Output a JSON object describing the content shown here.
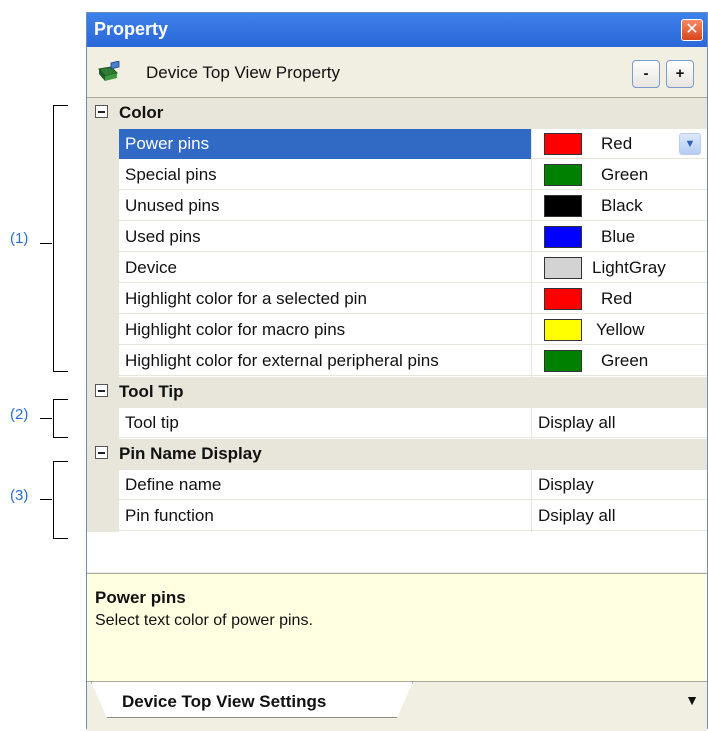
{
  "callouts": [
    "(1)",
    "(2)",
    "(3)"
  ],
  "panel": {
    "title": "Property",
    "close_glyph": "✕",
    "header_title": "Device Top View Property",
    "collapse_label": "-",
    "expand_label": "+",
    "icon": "device-chip-icon"
  },
  "categories": [
    {
      "label": "Color",
      "properties": [
        {
          "name": "Power pins",
          "value": "Red",
          "color": "#ff0000",
          "selected": true
        },
        {
          "name": "Special pins",
          "value": "Green",
          "color": "#008000"
        },
        {
          "name": "Unused pins",
          "value": "Black",
          "color": "#000000"
        },
        {
          "name": "Used pins",
          "value": "Blue",
          "color": "#0000ff"
        },
        {
          "name": "Device",
          "value": "LightGray",
          "color": "#d3d3d3"
        },
        {
          "name": "Highlight color for a selected pin",
          "value": "Red",
          "color": "#ff0000"
        },
        {
          "name": "Highlight color for macro pins",
          "value": "Yellow",
          "color": "#ffff00"
        },
        {
          "name": "Highlight color for external peripheral pins",
          "value": "Green",
          "color": "#008000"
        }
      ]
    },
    {
      "label": "Tool Tip",
      "properties": [
        {
          "name": "Tool tip",
          "value": "Display all"
        }
      ]
    },
    {
      "label": "Pin Name Display",
      "properties": [
        {
          "name": "Define name",
          "value": "Display"
        },
        {
          "name": "Pin function",
          "value": "Dsiplay all"
        }
      ]
    }
  ],
  "description": {
    "title": "Power pins",
    "text": "Select text color of power pins."
  },
  "tab": {
    "label": "Device Top View Settings",
    "menu_glyph": "▼"
  },
  "colors": {
    "selection": "#316ac5",
    "titlebar": "#2b67d8",
    "callout": "#2a6fd6"
  }
}
